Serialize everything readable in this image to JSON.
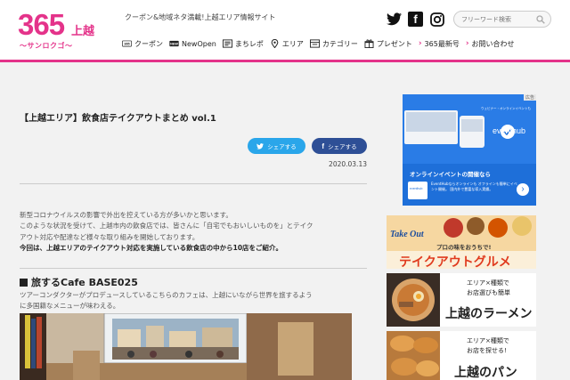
{
  "header": {
    "logo_number": "365",
    "logo_city": "上越",
    "logo_sub": "〜サンロクゴ〜",
    "tagline": "クーポン&地域ネタ満載!上越エリア情報サイト",
    "search_placeholder": "フリーワード検索"
  },
  "nav": {
    "items": [
      {
        "label": "クーポン",
        "icon": "coupon-icon"
      },
      {
        "label": "NewOpen",
        "icon": "new-icon"
      },
      {
        "label": "まちレポ",
        "icon": "report-icon"
      },
      {
        "label": "エリア",
        "icon": "map-pin-icon"
      },
      {
        "label": "カテゴリー",
        "icon": "category-icon"
      },
      {
        "label": "プレゼント",
        "icon": "gift-icon"
      }
    ],
    "links": [
      {
        "label": "365最新号"
      },
      {
        "label": "お問い合わせ"
      }
    ]
  },
  "article": {
    "title": "【上越エリア】飲食店テイクアウトまとめ vol.1",
    "share_twitter": "シェアする",
    "share_facebook": "シェアする",
    "date": "2020.03.13",
    "intro": [
      "新型コロナウイルスの影響で外出を控えている方が多いかと思います。",
      "このような状況を受けて、上越市内の飲食店では、皆さんに「自宅でもおいしいものを」とテイク",
      "アウト対応や配達など様々な取り組みを開始しております。"
    ],
    "intro_strong": "今回は、上越エリアのテイクアウト対応を実施している飲食店の中から10店をご紹介。",
    "section_title": "旅するCafe BASE025",
    "section_desc": [
      "ツアーコンダクターがプロデュースしているこちらのカフェは、上越にいながら世界を旅するよう",
      "に多国籍なメニューが味わえる。"
    ]
  },
  "sidebar": {
    "ad_tag": "広告",
    "ad_brand": "eventhub",
    "ad_headline": "オンラインイベントの開催なら",
    "ad_small": "EventHubならオンラインも オフラインも簡単にイベント開催。 国内外で豊富な導入実績。",
    "ad_logo_text": "eventhub",
    "ad_screen_caption": "ウェビナー・オンラインイベントも",
    "banner_takeout_small": "プロの味をおうちで!",
    "banner_takeout_script": "Take Out",
    "banner_takeout_big": "テイクアウトグルメ",
    "banner_ramen_sub1": "エリア×種類で",
    "banner_ramen_sub2": "お店選びも簡単",
    "banner_ramen_big": "上越のラーメン",
    "banner_bread_sub1": "エリア×種類で",
    "banner_bread_sub2": "お店を探せる!",
    "banner_bread_big": "上越のパン"
  },
  "colors": {
    "accent": "#e4338a",
    "twitter": "#2aa6ea",
    "facebook": "#2e4f96",
    "eventhub_blue": "#1e6fd9",
    "takeout_red": "#e03a1e"
  }
}
